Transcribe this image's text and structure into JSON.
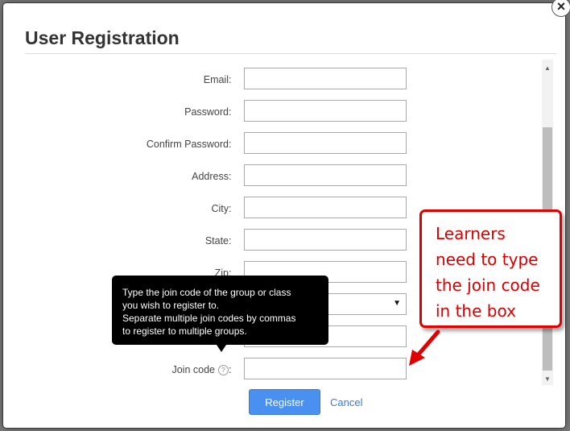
{
  "dialog": {
    "title": "User Registration",
    "fields": [
      {
        "label": "Email",
        "value": ""
      },
      {
        "label": "Password",
        "value": ""
      },
      {
        "label": "Confirm Password",
        "value": ""
      },
      {
        "label": "Address",
        "value": ""
      },
      {
        "label": "City",
        "value": ""
      },
      {
        "label": "State",
        "value": ""
      },
      {
        "label": "Zip",
        "value": ""
      },
      {
        "label": "",
        "value": ""
      },
      {
        "label": "",
        "value": ""
      },
      {
        "label": "Join code",
        "value": ""
      }
    ],
    "colon": ":",
    "help_icon": "?",
    "tooltip": {
      "lines": [
        "Type the join code of the group or class",
        "you wish to register to.",
        "Separate multiple join codes by commas",
        "to register to multiple groups."
      ]
    },
    "register_label": "Register",
    "cancel_label": "Cancel"
  },
  "callout": {
    "lines": [
      "Learners",
      "need to type",
      "the join code",
      "in the box"
    ],
    "color": "#e00000"
  },
  "icons": {
    "close": "close-icon",
    "dropdown": "chevron-down-icon",
    "help": "question-circle-icon"
  }
}
